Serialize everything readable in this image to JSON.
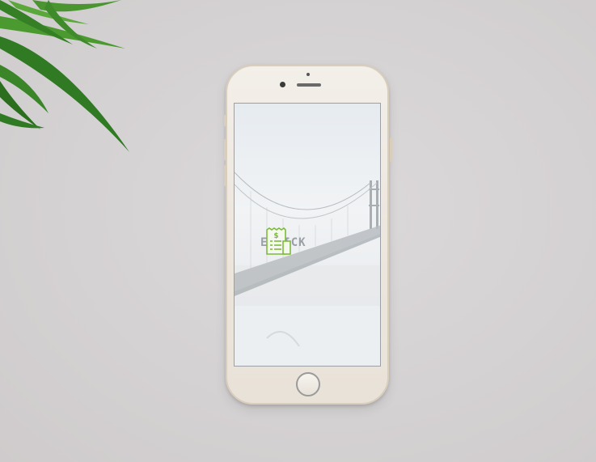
{
  "app": {
    "logo_text": "E-TICK",
    "logo_icon": "receipt-dollar-icon"
  },
  "colors": {
    "background": "#d6d3d4",
    "phone_body": "#ece6dd",
    "accent_green": "#7dbb3a"
  },
  "icons": [
    "plant-leaves-icon",
    "receipt-dollar-icon",
    "home-button",
    "front-camera-icon",
    "earpiece-speaker-icon"
  ]
}
